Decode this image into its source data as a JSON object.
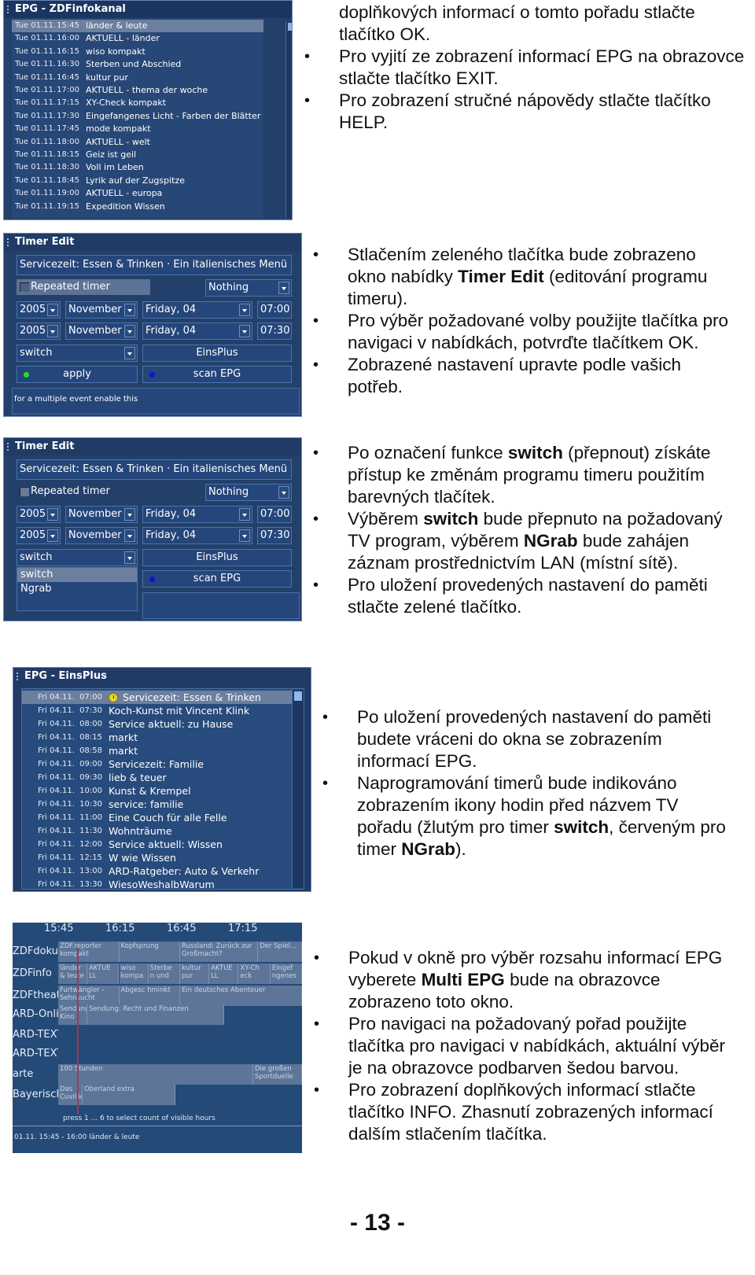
{
  "page_number": "- 13 -",
  "sections": [
    {
      "continued_text": "doplňkových informací o tomto pořadu stlačte tlačítko OK.",
      "bullets": [
        {
          "parts": [
            {
              "t": "Pro vyjití ze zobrazení informací EPG na obrazovce stlačte tlačítko EXIT.",
              "b": false
            }
          ]
        },
        {
          "parts": [
            {
              "t": "Pro zobrazení stručné nápovědy stlačte tlačítko HELP.",
              "b": false
            }
          ]
        }
      ]
    },
    {
      "bullets": [
        {
          "parts": [
            {
              "t": "Stlačením zeleného tlačítka bude zobrazeno okno nabídky ",
              "b": false
            },
            {
              "t": "Timer Edit",
              "b": true
            },
            {
              "t": " (editování programu timeru).",
              "b": false
            }
          ]
        },
        {
          "parts": [
            {
              "t": "Pro výběr požadované volby použijte tlačítka pro navigaci v nabídkách, potvrďte tlačítkem OK.",
              "b": false
            }
          ]
        },
        {
          "parts": [
            {
              "t": "Zobrazené nastavení upravte podle vašich potřeb.",
              "b": false
            }
          ]
        }
      ]
    },
    {
      "bullets": [
        {
          "parts": [
            {
              "t": "Po označení funkce ",
              "b": false
            },
            {
              "t": "switch",
              "b": true
            },
            {
              "t": " (přepnout) získáte přístup ke změnám programu timeru použitím barevných tlačítek.",
              "b": false
            }
          ]
        },
        {
          "parts": [
            {
              "t": "Výběrem ",
              "b": false
            },
            {
              "t": "switch",
              "b": true
            },
            {
              "t": " bude přepnuto na požadovaný TV program, výběrem ",
              "b": false
            },
            {
              "t": "NGrab",
              "b": true
            },
            {
              "t": " bude zahájen záznam prostřednictvím LAN (místní sítě).",
              "b": false
            }
          ]
        },
        {
          "parts": [
            {
              "t": "Pro uložení provedených nastavení do paměti stlačte zelené tlačítko.",
              "b": false
            }
          ]
        }
      ]
    },
    {
      "bullets": [
        {
          "parts": [
            {
              "t": "Po uložení provedených nastavení do paměti budete vráceni do okna se zobrazením informací EPG.",
              "b": false
            }
          ]
        },
        {
          "parts": [
            {
              "t": "Naprogramování timerů bude indikováno zobrazením ikony hodin před názvem TV pořadu (žlutým pro timer ",
              "b": false
            },
            {
              "t": "switch",
              "b": true
            },
            {
              "t": ", červeným pro timer ",
              "b": false
            },
            {
              "t": "NGrab",
              "b": true
            },
            {
              "t": ").",
              "b": false
            }
          ]
        }
      ]
    },
    {
      "bullets": [
        {
          "parts": [
            {
              "t": "Pokud v okně pro výběr rozsahu informací EPG vyberete ",
              "b": false
            },
            {
              "t": "Multi EPG",
              "b": true
            },
            {
              "t": " bude na obrazovce zobrazeno toto okno.",
              "b": false
            }
          ]
        },
        {
          "parts": [
            {
              "t": "Pro navigaci na požadovaný pořad použijte tlačítka pro navigaci v nabídkách, aktuální výběr je na obrazovce podbarven šedou barvou.",
              "b": false
            }
          ]
        },
        {
          "parts": [
            {
              "t": "Pro zobrazení doplňkových informací stlačte tlačítko INFO. Zhasnutí zobrazených informací dalším stlačením tlačítka.",
              "b": false
            }
          ]
        }
      ]
    }
  ],
  "epg_zdfinfo": {
    "title": "EPG - ZDFinfokanal",
    "rows": [
      {
        "date": "Tue 01.11.",
        "time": "15:45",
        "name": "länder & leute",
        "selected": true
      },
      {
        "date": "Tue 01.11.",
        "time": "16:00",
        "name": "AKTUELL - länder"
      },
      {
        "date": "Tue 01.11.",
        "time": "16:15",
        "name": "wiso kompakt"
      },
      {
        "date": "Tue 01.11.",
        "time": "16:30",
        "name": "Sterben und Abschied"
      },
      {
        "date": "Tue 01.11.",
        "time": "16:45",
        "name": "kultur pur"
      },
      {
        "date": "Tue 01.11.",
        "time": "17:00",
        "name": "AKTUELL - thema der woche"
      },
      {
        "date": "Tue 01.11.",
        "time": "17:15",
        "name": "XY-Check kompakt"
      },
      {
        "date": "Tue 01.11.",
        "time": "17:30",
        "name": "Eingefangenes Licht - Farben der Blätter"
      },
      {
        "date": "Tue 01.11.",
        "time": "17:45",
        "name": "mode kompakt"
      },
      {
        "date": "Tue 01.11.",
        "time": "18:00",
        "name": "AKTUELL - welt"
      },
      {
        "date": "Tue 01.11.",
        "time": "18:15",
        "name": "Geiz ist geil"
      },
      {
        "date": "Tue 01.11.",
        "time": "18:30",
        "name": "Voll im Leben"
      },
      {
        "date": "Tue 01.11.",
        "time": "18:45",
        "name": "Lyrik auf der Zugspitze"
      },
      {
        "date": "Tue 01.11.",
        "time": "19:00",
        "name": "AKTUELL - europa"
      },
      {
        "date": "Tue 01.11.",
        "time": "19:15",
        "name": "Expedition Wissen"
      }
    ]
  },
  "timer_edit_1": {
    "title": "Timer Edit",
    "event_title": "Servicezeit: Essen & Trinken · Ein italienisches Menü · Die fre",
    "repeated_label": "Repeated timer",
    "repeat_value": "Nothing",
    "start": {
      "year": "2005",
      "month": "November",
      "day": "Friday, 04",
      "time": "07:00"
    },
    "end": {
      "year": "2005",
      "month": "November",
      "day": "Friday, 04",
      "time": "07:30"
    },
    "action": "switch",
    "channel": "EinsPlus",
    "apply_label": "apply",
    "scan_label": "scan EPG",
    "hint": "for a multiple event enable this",
    "colors": {
      "green": "#1ee01e",
      "blue": "#1010e0"
    }
  },
  "timer_edit_2": {
    "title": "Timer Edit",
    "event_title": "Servicezeit: Essen & Trinken · Ein italienisches Menü · Die fre",
    "repeated_label": "Repeated timer",
    "repeat_value": "Nothing",
    "start": {
      "year": "2005",
      "month": "November",
      "day": "Friday, 04",
      "time": "07:00"
    },
    "end": {
      "year": "2005",
      "month": "November",
      "day": "Friday, 04",
      "time": "07:30"
    },
    "action": "switch",
    "action_options": [
      "switch",
      "Ngrab"
    ],
    "channel": "EinsPlus",
    "scan_label": "scan EPG"
  },
  "epg_einsplus": {
    "title": "EPG - EinsPlus",
    "rows": [
      {
        "date": "Fri 04.11.",
        "time": "07:00",
        "name": "Servicezeit: Essen & Trinken",
        "selected": true,
        "timer_icon": "yellow"
      },
      {
        "date": "Fri 04.11.",
        "time": "07:30",
        "name": "Koch-Kunst mit Vincent Klink"
      },
      {
        "date": "Fri 04.11.",
        "time": "08:00",
        "name": "Service aktuell: zu Hause"
      },
      {
        "date": "Fri 04.11.",
        "time": "08:15",
        "name": "markt"
      },
      {
        "date": "Fri 04.11.",
        "time": "08:58",
        "name": "markt"
      },
      {
        "date": "Fri 04.11.",
        "time": "09:00",
        "name": "Servicezeit: Familie"
      },
      {
        "date": "Fri 04.11.",
        "time": "09:30",
        "name": "lieb & teuer"
      },
      {
        "date": "Fri 04.11.",
        "time": "10:00",
        "name": "Kunst & Krempel"
      },
      {
        "date": "Fri 04.11.",
        "time": "10:30",
        "name": "service: familie"
      },
      {
        "date": "Fri 04.11.",
        "time": "11:00",
        "name": "Eine Couch für alle Felle"
      },
      {
        "date": "Fri 04.11.",
        "time": "11:30",
        "name": "Wohnträume"
      },
      {
        "date": "Fri 04.11.",
        "time": "12:00",
        "name": "Service aktuell: Wissen"
      },
      {
        "date": "Fri 04.11.",
        "time": "12:15",
        "name": "W wie Wissen"
      },
      {
        "date": "Fri 04.11.",
        "time": "13:00",
        "name": "ARD-Ratgeber: Auto & Verkehr"
      },
      {
        "date": "Fri 04.11.",
        "time": "13:30",
        "name": "WiesoWeshalbWarum"
      }
    ]
  },
  "multi_epg": {
    "hours": [
      "15:45",
      "16:15",
      "16:45",
      "17:15"
    ],
    "channels": [
      {
        "name": "ZDFdoku",
        "programs": [
          {
            "title": "ZDF.reporter kompakt",
            "start": 0,
            "end": 0.25
          },
          {
            "title": "Kopfsprung",
            "start": 0.25,
            "end": 0.5
          },
          {
            "title": "Russland: Zurück zur Großmacht?",
            "start": 0.5,
            "end": 0.82
          },
          {
            "title": "Der Spiel...",
            "start": 0.82,
            "end": 1
          }
        ]
      },
      {
        "name": "ZDFinfo",
        "programs": [
          {
            "title": "länder & leute",
            "start": 0,
            "end": 0.12
          },
          {
            "title": "AKTUE LL",
            "start": 0.12,
            "end": 0.25
          },
          {
            "title": "wiso kompa",
            "start": 0.25,
            "end": 0.37
          },
          {
            "title": "Sterbe n und",
            "start": 0.37,
            "end": 0.5
          },
          {
            "title": "kultur pur",
            "start": 0.5,
            "end": 0.62
          },
          {
            "title": "AKTUE LL",
            "start": 0.62,
            "end": 0.74
          },
          {
            "title": "XY-Ch eck",
            "start": 0.74,
            "end": 0.87
          },
          {
            "title": "Eingef ngenes",
            "start": 0.87,
            "end": 1
          }
        ]
      },
      {
        "name": "ZDFtheater",
        "programs": [
          {
            "title": "Furtwängler - Sehnsucht",
            "start": 0,
            "end": 0.25
          },
          {
            "title": "Abgesc hminkt",
            "start": 0.25,
            "end": 0.5
          },
          {
            "title": "Ein deutsches Abenteuer",
            "start": 0.5,
            "end": 1
          }
        ]
      },
      {
        "name": "ARD-Online",
        "programs": [
          {
            "title": "Sendung Kino",
            "start": 0,
            "end": 0.12
          },
          {
            "title": "Sendung: Recht und Finanzen",
            "start": 0.12,
            "end": 0.68
          }
        ]
      },
      {
        "name": "ARD-TEXT",
        "programs": []
      },
      {
        "name": "ARD-TEXT",
        "programs": []
      },
      {
        "name": "arte",
        "programs": [
          {
            "title": "100 Stunden",
            "start": 0,
            "end": 0.8
          },
          {
            "title": "Die großen Sportduelle",
            "start": 0.8,
            "end": 1
          }
        ]
      },
      {
        "name": "Bayerisches",
        "programs": [
          {
            "title": "Das Cuvilliés",
            "start": 0,
            "end": 0.1
          },
          {
            "title": "Oberland extra",
            "start": 0.1,
            "end": 0.48
          }
        ]
      }
    ],
    "footer_hint": "press 1 ... 6 to select count of visible hours",
    "status": "01.11. 15:45 - 16:00 länder & leute"
  }
}
